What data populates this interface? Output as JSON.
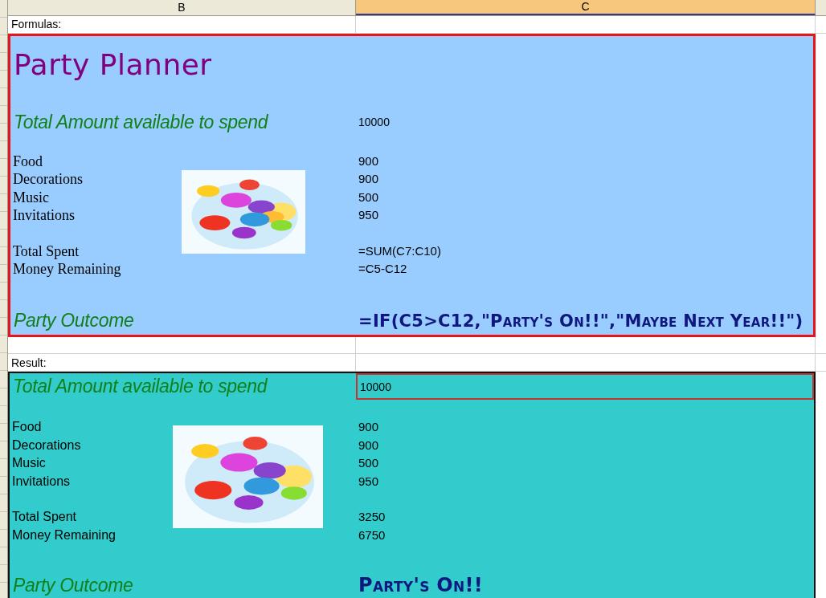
{
  "column_headers": [
    {
      "label": "B",
      "selected": false
    },
    {
      "label": "C",
      "selected": true
    }
  ],
  "sections": [
    {
      "kind": "formulas",
      "label": "Formulas:",
      "title": "Party Planner",
      "total": {
        "label": "Total Amount available to spend",
        "value": "10000",
        "selected": false
      },
      "items": [
        {
          "label": "Food",
          "value": "900"
        },
        {
          "label": "Decorations",
          "value": "900"
        },
        {
          "label": "Music",
          "value": "500"
        },
        {
          "label": "Invitations",
          "value": "950"
        }
      ],
      "summary": [
        {
          "label": "Total Spent",
          "value": "=SUM(C7:C10)"
        },
        {
          "label": "Money Remaining",
          "value": "=C5-C12"
        }
      ],
      "outcome": {
        "label": "Party Outcome",
        "value": "=IF(C5>C12,\"Party's On!!\",\"Maybe Next Year!!\")"
      }
    },
    {
      "kind": "result",
      "label": "Result:",
      "total": {
        "label": "Total Amount available to spend",
        "value": "10000",
        "selected": true
      },
      "items": [
        {
          "label": "Food",
          "value": "900"
        },
        {
          "label": "Decorations",
          "value": "900"
        },
        {
          "label": "Music",
          "value": "500"
        },
        {
          "label": "Invitations",
          "value": "950"
        }
      ],
      "summary": [
        {
          "label": "Total Spent",
          "value": "3250"
        },
        {
          "label": "Money Remaining",
          "value": "6750"
        }
      ],
      "outcome": {
        "label": "Party Outcome",
        "value": "Party's On!!"
      }
    }
  ]
}
